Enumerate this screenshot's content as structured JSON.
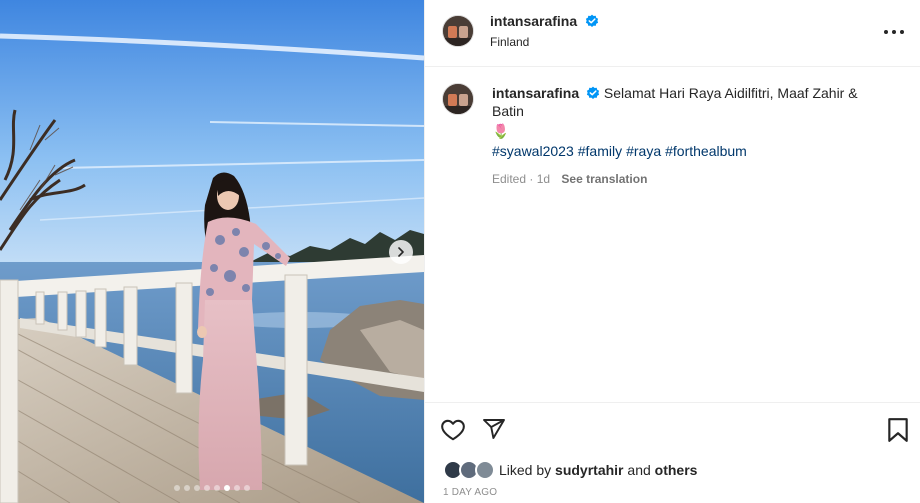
{
  "post": {
    "username": "intansarafina",
    "location": "Finland",
    "caption_text": "Selamat Hari Raya Aidilfitri, Maaf Zahir & Batin",
    "caption_emoji": "🌷",
    "hashtags": [
      "#syawal2023",
      "#family",
      "#raya",
      "#forthealbum"
    ],
    "edited_label": "Edited · 1d",
    "see_translation": "See translation",
    "liked_by_prefix": "Liked by",
    "liked_by_user": "sudyrtahir",
    "liked_by_and": "and",
    "liked_by_others": "others",
    "time_ago": "1 DAY AGO"
  },
  "carousel": {
    "slide_count": 8,
    "active_index": 5
  },
  "icons": {
    "verified": "verified-badge-icon",
    "more": "more-options-icon",
    "like": "heart-icon",
    "share": "send-icon",
    "save": "bookmark-icon",
    "next": "chevron-right-icon"
  },
  "colors": {
    "verified": "#0095f6",
    "hashtag": "#00376b",
    "muted": "#8e8e8e"
  }
}
